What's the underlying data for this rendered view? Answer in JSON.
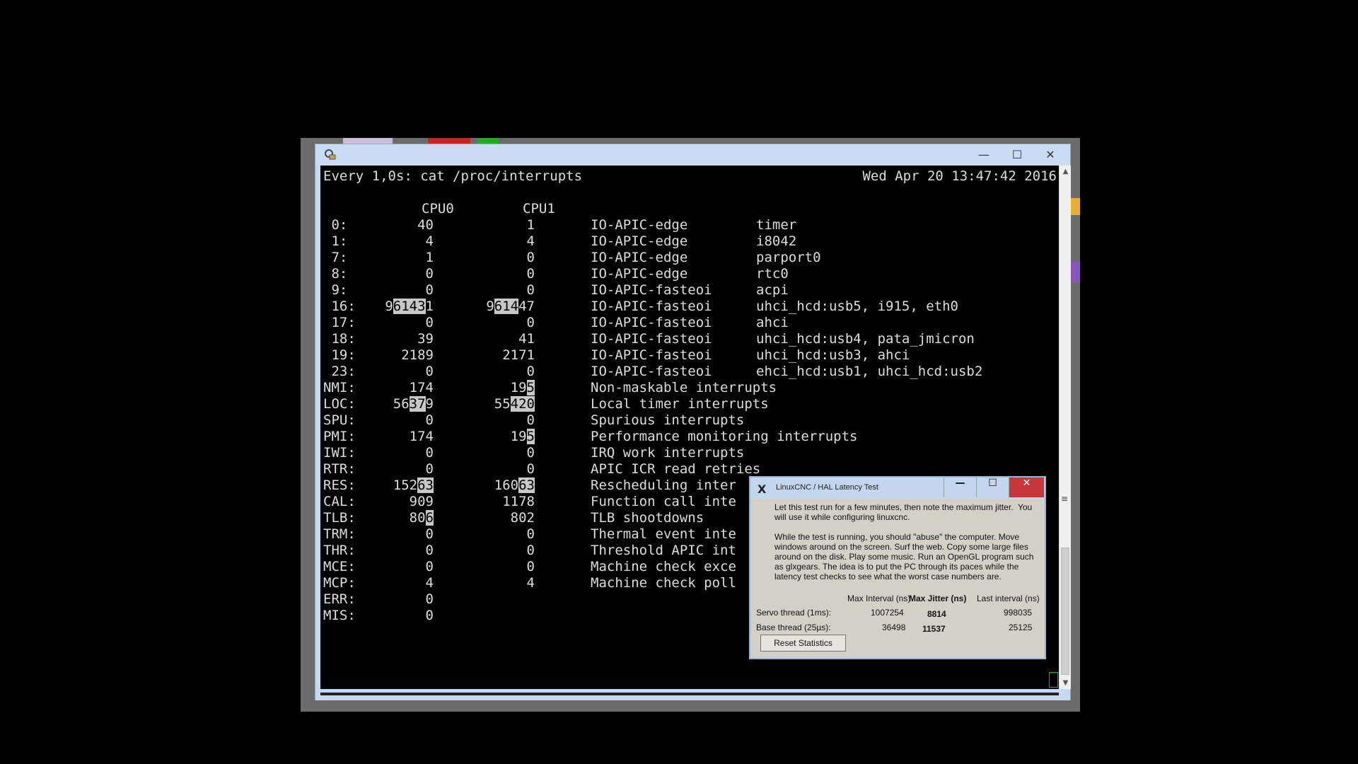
{
  "terminal": {
    "command_header": "Every 1,0s: cat /proc/interrupts",
    "date": "Wed Apr 20 13:47:42 2016",
    "columns": [
      "CPU0",
      "CPU1"
    ],
    "rows": [
      {
        "name": " 0:",
        "cpu0": "40",
        "cpu1": "1",
        "type": "IO-APIC-edge",
        "device": "timer"
      },
      {
        "name": " 1:",
        "cpu0": "4",
        "cpu1": "4",
        "type": "IO-APIC-edge",
        "device": "i8042"
      },
      {
        "name": " 7:",
        "cpu0": "1",
        "cpu1": "0",
        "type": "IO-APIC-edge",
        "device": "parport0"
      },
      {
        "name": " 8:",
        "cpu0": "0",
        "cpu1": "0",
        "type": "IO-APIC-edge",
        "device": "rtc0"
      },
      {
        "name": " 9:",
        "cpu0": "0",
        "cpu1": "0",
        "type": "IO-APIC-fasteoi",
        "device": "acpi"
      },
      {
        "name": " 16:",
        "cpu0": "961431",
        "cpu1": "961447",
        "type": "IO-APIC-fasteoi",
        "device": "uhci_hcd:usb5, i915, eth0"
      },
      {
        "name": " 17:",
        "cpu0": "0",
        "cpu1": "0",
        "type": "IO-APIC-fasteoi",
        "device": "ahci"
      },
      {
        "name": " 18:",
        "cpu0": "39",
        "cpu1": "41",
        "type": "IO-APIC-fasteoi",
        "device": "uhci_hcd:usb4, pata_jmicron"
      },
      {
        "name": " 19:",
        "cpu0": "2189",
        "cpu1": "2171",
        "type": "IO-APIC-fasteoi",
        "device": "uhci_hcd:usb3, ahci"
      },
      {
        "name": " 23:",
        "cpu0": "0",
        "cpu1": "0",
        "type": "IO-APIC-fasteoi",
        "device": "ehci_hcd:usb1, uhci_hcd:usb2"
      },
      {
        "name": "NMI:",
        "cpu0": "174",
        "cpu1": "195",
        "type": "Non-maskable interrupts",
        "device": ""
      },
      {
        "name": "LOC:",
        "cpu0": "56379",
        "cpu1": "55420",
        "type": "Local timer interrupts",
        "device": ""
      },
      {
        "name": "SPU:",
        "cpu0": "0",
        "cpu1": "0",
        "type": "Spurious interrupts",
        "device": ""
      },
      {
        "name": "PMI:",
        "cpu0": "174",
        "cpu1": "195",
        "type": "Performance monitoring interrupts",
        "device": ""
      },
      {
        "name": "IWI:",
        "cpu0": "0",
        "cpu1": "0",
        "type": "IRQ work interrupts",
        "device": ""
      },
      {
        "name": "RTR:",
        "cpu0": "0",
        "cpu1": "0",
        "type": "APIC ICR read retries",
        "device": ""
      },
      {
        "name": "RES:",
        "cpu0": "15263",
        "cpu1": "16063",
        "type": "Rescheduling inter",
        "device": ""
      },
      {
        "name": "CAL:",
        "cpu0": "909",
        "cpu1": "1178",
        "type": "Function call inte",
        "device": ""
      },
      {
        "name": "TLB:",
        "cpu0": "806",
        "cpu1": "802",
        "type": "TLB shootdowns",
        "device": ""
      },
      {
        "name": "TRM:",
        "cpu0": "0",
        "cpu1": "0",
        "type": "Thermal event inte",
        "device": ""
      },
      {
        "name": "THR:",
        "cpu0": "0",
        "cpu1": "0",
        "type": "Threshold APIC int",
        "device": ""
      },
      {
        "name": "MCE:",
        "cpu0": "0",
        "cpu1": "0",
        "type": "Machine check exce",
        "device": ""
      },
      {
        "name": "MCP:",
        "cpu0": "4",
        "cpu1": "4",
        "type": "Machine check poll",
        "device": ""
      },
      {
        "name": "ERR:",
        "cpu0": "0",
        "cpu1": "",
        "type": "",
        "device": ""
      },
      {
        "name": "MIS:",
        "cpu0": "0",
        "cpu1": "",
        "type": "",
        "device": ""
      }
    ]
  },
  "latency_window": {
    "title": "LinuxCNC / HAL Latency Test",
    "intro": "Let this test run for a few minutes, then note the maximum jitter.  You will use it while configuring linuxcnc.\n\nWhile the test is running, you should \"abuse\" the computer. Move windows around on the screen. Surf the web. Copy some large files around on the disk. Play some music. Run an OpenGL program such as glxgears. The idea is to put the PC through its paces while the latency test checks to see what the worst case numbers are.",
    "headers": {
      "max_interval": "Max Interval (ns)",
      "max_jitter": "Max Jitter (ns)",
      "last_interval": "Last interval (ns)"
    },
    "servo": {
      "label": "Servo thread (1ms):",
      "max_interval": "1007254",
      "max_jitter": "8814",
      "last_interval": "998035"
    },
    "base": {
      "label": "Base thread (25µs):",
      "max_interval": "36498",
      "max_jitter": "11537",
      "last_interval": "25125"
    },
    "reset_label": "Reset Statistics",
    "close_symbol": "✕",
    "min_symbol": "—",
    "max_symbol": "☐"
  },
  "terminal_window": {
    "min_symbol": "—",
    "max_symbol": "☐",
    "close_symbol": "✕",
    "scroll_up": "▲",
    "scroll_down": "▼",
    "grip": "≡"
  },
  "colors": {
    "terminal_bg": "#000000",
    "terminal_fg": "#dddddd",
    "highlight": "#c8c8c8",
    "close_red": "#c8383a"
  }
}
